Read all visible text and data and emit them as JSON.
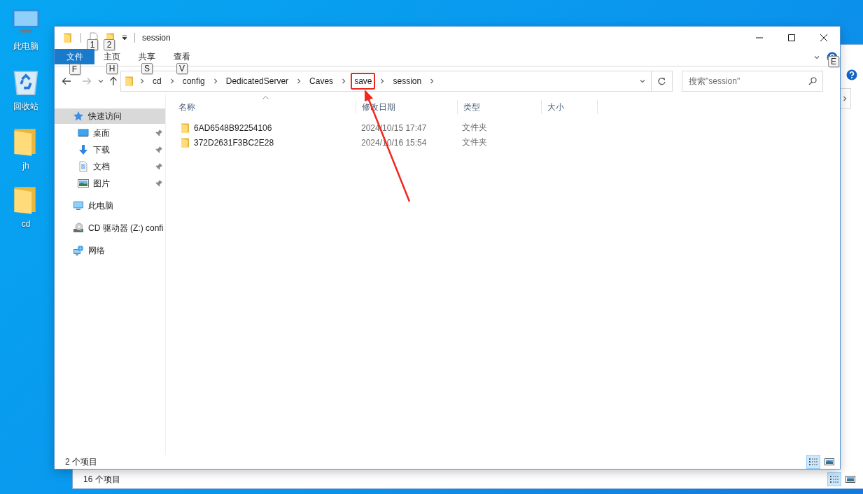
{
  "desktop": {
    "icons": [
      {
        "label": "此电脑",
        "kind": "computer"
      },
      {
        "label": "回收站",
        "kind": "recycle-bin"
      },
      {
        "label": "jh",
        "kind": "folder"
      },
      {
        "label": "cd",
        "kind": "folder"
      }
    ]
  },
  "back_window": {
    "status_bar": {
      "item_count": "16 个项目",
      "views": [
        {
          "kind": "details",
          "selected": true
        },
        {
          "kind": "thumbnails",
          "selected": false
        }
      ]
    }
  },
  "window": {
    "title": "session",
    "quick_access": [
      {
        "kind": "properties",
        "key_tip": "1"
      },
      {
        "kind": "new-folder",
        "key_tip": "2"
      }
    ],
    "ribbon_tabs": [
      {
        "label": "文件",
        "kind": "file",
        "key_tip": "F"
      },
      {
        "label": "主页",
        "kind": "tab",
        "key_tip": "H"
      },
      {
        "label": "共享",
        "kind": "tab",
        "key_tip": "S"
      },
      {
        "label": "查看",
        "kind": "tab",
        "key_tip": "V"
      }
    ],
    "help_key_tip": "E",
    "address": {
      "crumbs": [
        {
          "label": "cd",
          "highlighted": false
        },
        {
          "label": "config",
          "highlighted": false
        },
        {
          "label": "DedicatedServer",
          "highlighted": false
        },
        {
          "label": "Caves",
          "highlighted": false
        },
        {
          "label": "save",
          "highlighted": true
        },
        {
          "label": "session",
          "highlighted": false
        }
      ]
    },
    "search": {
      "placeholder": "搜索\"session\""
    },
    "navigation": [
      {
        "label": "快速访问",
        "kind": "star",
        "selected": true,
        "children": [
          {
            "label": "桌面",
            "kind": "desktop",
            "pinned": true
          },
          {
            "label": "下载",
            "kind": "download",
            "pinned": true
          },
          {
            "label": "文档",
            "kind": "document",
            "pinned": true
          },
          {
            "label": "图片",
            "kind": "pictures",
            "pinned": true
          }
        ]
      },
      {
        "label": "此电脑",
        "kind": "computer",
        "selected": false
      },
      {
        "label": "CD 驱动器 (Z:) confi",
        "kind": "cd-drive",
        "selected": false
      },
      {
        "label": "网络",
        "kind": "network",
        "selected": false
      }
    ],
    "columns": [
      {
        "label": "名称",
        "sorted": true
      },
      {
        "label": "修改日期",
        "sorted": false
      },
      {
        "label": "类型",
        "sorted": false
      },
      {
        "label": "大小",
        "sorted": false
      }
    ],
    "rows": [
      {
        "name": "6AD6548B92254106",
        "modified": "2024/10/15 17:47",
        "type": "文件夹"
      },
      {
        "name": "372D2631F3BC2E28",
        "modified": "2024/10/16 15:54",
        "type": "文件夹"
      }
    ],
    "status_bar": {
      "item_count": "2 个项目",
      "views": [
        {
          "kind": "details",
          "selected": true
        },
        {
          "kind": "thumbnails",
          "selected": false
        }
      ]
    }
  }
}
